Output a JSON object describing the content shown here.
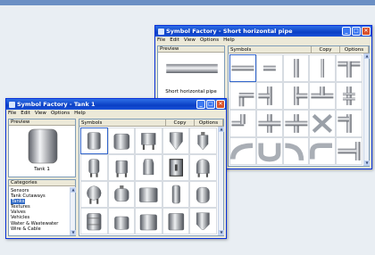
{
  "desktop": {
    "background": "#e9eef3",
    "strip_color": "#6b8fc4"
  },
  "pipe_window": {
    "title": "Symbol Factory - Short horizontal pipe",
    "menu": [
      "File",
      "Edit",
      "View",
      "Options",
      "Help"
    ],
    "preview_header": "Preview",
    "preview_caption": "Short horizontal pipe",
    "symbols_header": "Symbols",
    "copy_label": "Copy",
    "options_label": "Options",
    "symbol_icons": [
      "straight-horizontal-pipe-icon",
      "short-horizontal-pipe-icon",
      "vertical-pipe-icon",
      "vertical-pipe-thin-icon",
      "tee-down-pipe-icon",
      "elbow-down-right-pipe-icon",
      "tee-left-pipe-icon",
      "tee-right-pipe-icon",
      "tee-up-pipe-icon",
      "valve-pipe-icon",
      "elbow-left-pipe-icon",
      "tee-junction-pipe-icon",
      "cross-pipe-icon",
      "cross-x-pipe-icon",
      "branch-pipe-icon",
      "bend-pipe-icon",
      "u-bend-pipe-icon",
      "curve-pipe-icon",
      "elbow-up-pipe-icon",
      "corner-pipe-icon"
    ]
  },
  "tank_window": {
    "title": "Symbol Factory - Tank 1",
    "menu": [
      "File",
      "Edit",
      "View",
      "Options",
      "Help"
    ],
    "preview_header": "Preview",
    "preview_caption": "Tank 1",
    "categories_header": "Categories",
    "categories": [
      "Sensors",
      "Tank Cutaways",
      "Tanks",
      "Textures",
      "Valves",
      "Vehicles",
      "Water & Wastewater",
      "Wire & Cable"
    ],
    "selected_category": "Tanks",
    "symbols_header": "Symbols",
    "copy_label": "Copy",
    "options_label": "Options",
    "symbol_icons": [
      "tank-1-icon",
      "tank-2-icon",
      "tank-3-icon",
      "cone-tank-icon",
      "silo-icon",
      "vessel-icon",
      "tank-legs-icon",
      "bottle-tank-icon",
      "framed-tank-icon",
      "dome-tank-icon",
      "sphere-tank-icon",
      "mixer-tank-icon",
      "box-tank-icon",
      "cylinder-tank-icon",
      "round-tank-icon",
      "drum-tank-icon",
      "short-tank-icon",
      "flat-tank-icon",
      "large-tank-icon",
      "hopper-tank-icon"
    ]
  }
}
